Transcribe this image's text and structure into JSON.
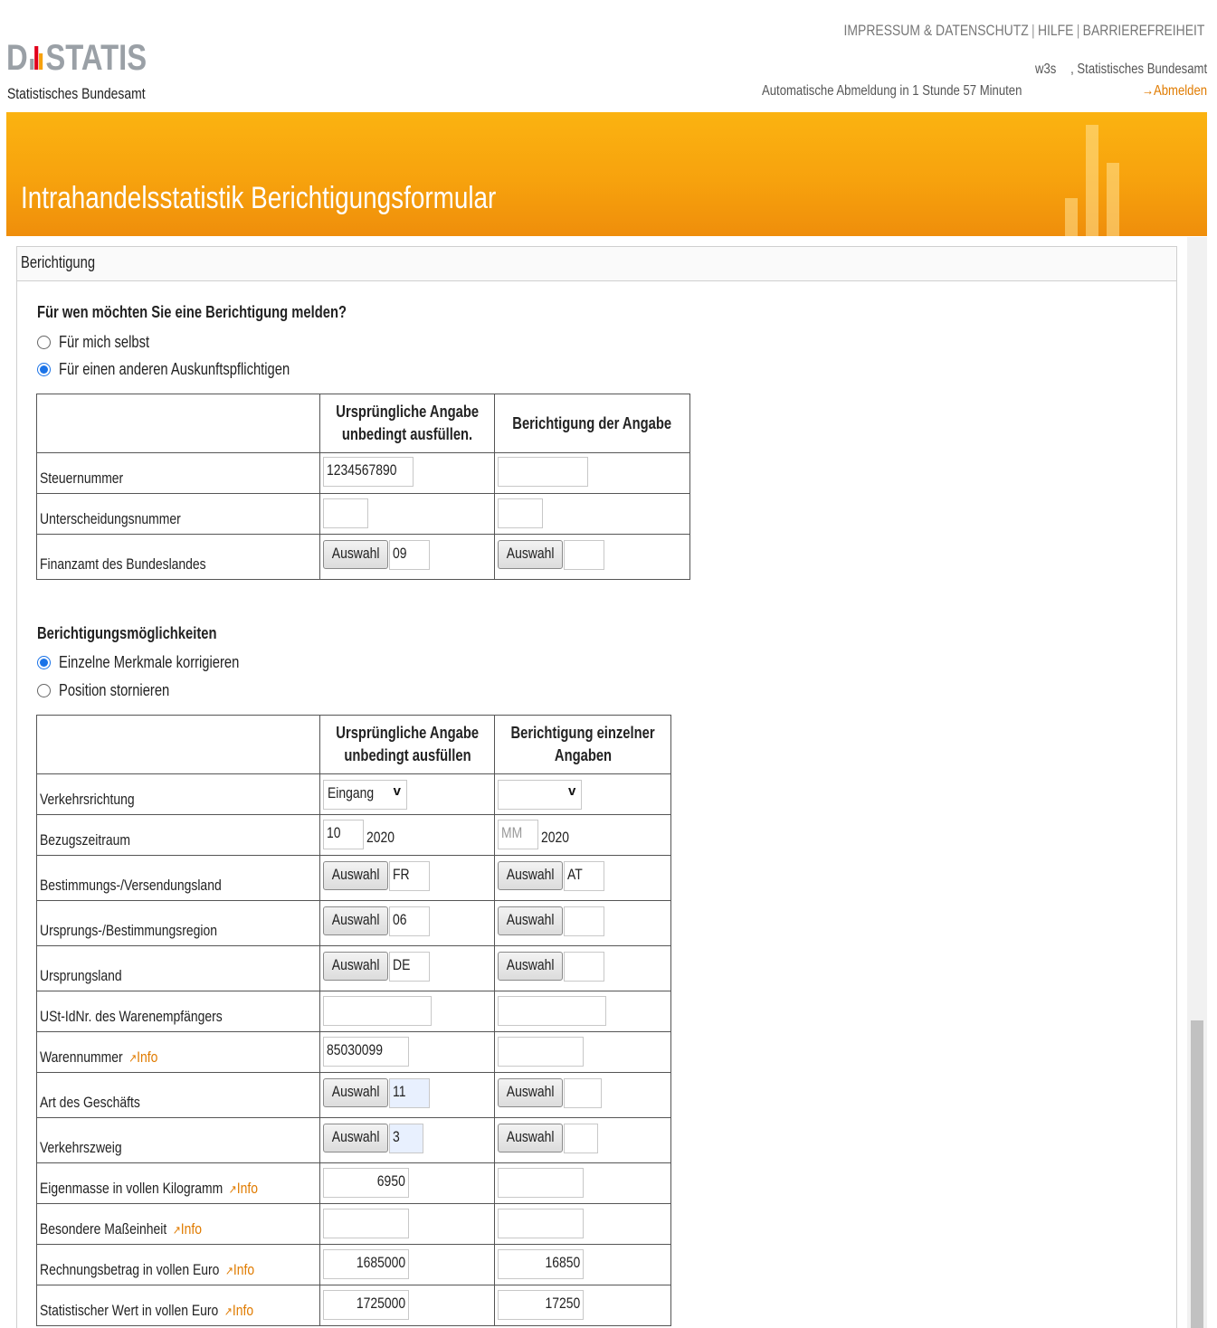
{
  "header": {
    "logo_text_d": "D",
    "logo_text_statis": "STATIS",
    "logo_sub": "Statistisches Bundesamt",
    "top_links": [
      "IMPRESSUM & DATENSCHUTZ",
      "HILFE",
      "BARRIEREFREIHEIT"
    ],
    "user": "w3s",
    "organisation": ", Statistisches Bundesamt",
    "autologout": "Automatische Abmeldung in 1 Stunde 57 Minuten",
    "logout": "Abmelden",
    "logout_arrow": "→"
  },
  "banner": {
    "title": "Intrahandelsstatistik Berichtigungsformular"
  },
  "panel": {
    "title": "Berichtigung"
  },
  "section1": {
    "question": "Für wen möchten Sie eine Berichtigung melden?",
    "options": [
      "Für mich selbst",
      "Für einen anderen Auskunftspflichtigen"
    ],
    "selected_index": 1,
    "table": {
      "col_original": [
        "Ursprüngliche Angabe",
        "unbedingt ausfüllen."
      ],
      "col_correction": "Berichtigung der Angabe",
      "rows": {
        "steuernummer": {
          "label": "Steuernummer",
          "original": "1234567890",
          "correction": ""
        },
        "unterscheidungsnummer": {
          "label": "Unterscheidungsnummer",
          "original": "",
          "correction": ""
        },
        "finanzamt": {
          "label": "Finanzamt des Bundeslandes",
          "original": "09",
          "correction": ""
        }
      }
    }
  },
  "section2": {
    "question": "Berichtigungsmöglichkeiten",
    "options": [
      "Einzelne Merkmale korrigieren",
      "Position stornieren"
    ],
    "selected_index": 0,
    "table": {
      "col_original": [
        "Ursprüngliche Angabe",
        "unbedingt ausfüllen"
      ],
      "col_correction": [
        "Berichtigung einzelner",
        "Angaben"
      ],
      "rows": {
        "verkehrsrichtung": {
          "label": "Verkehrsrichtung",
          "original": "Eingang",
          "correction": ""
        },
        "bezugszeitraum": {
          "label": "Bezugszeitraum",
          "original_month": "10",
          "original_year": "2020",
          "correction_month_placeholder": "MM",
          "correction_year": "2020"
        },
        "bestimmungsland": {
          "label": "Bestimmungs-/Versendungsland",
          "original": "FR",
          "correction": "AT"
        },
        "region": {
          "label": "Ursprungs-/Bestimmungsregion",
          "original": "06",
          "correction": ""
        },
        "ursprungsland": {
          "label": "Ursprungsland",
          "original": "DE",
          "correction": ""
        },
        "ustid": {
          "label": "USt-IdNr. des Warenempfängers",
          "original": "",
          "correction": ""
        },
        "warennummer": {
          "label": "Warennummer",
          "original": "85030099",
          "correction": ""
        },
        "art_geschaeft": {
          "label": "Art des Geschäfts",
          "original": "11",
          "correction": ""
        },
        "verkehrszweig": {
          "label": "Verkehrszweig",
          "original": "3",
          "correction": ""
        },
        "eigenmasse": {
          "label": "Eigenmasse in vollen Kilogramm",
          "original": "6950",
          "correction": ""
        },
        "masseinheit": {
          "label": "Besondere Maßeinheit",
          "original": "",
          "correction": ""
        },
        "rechnungsbetrag": {
          "label": "Rechnungsbetrag in vollen Euro",
          "original": "1685000",
          "correction": "16850"
        },
        "stat_wert": {
          "label": "Statistischer Wert in vollen Euro",
          "original": "1725000",
          "correction": "17250"
        }
      }
    }
  },
  "labels": {
    "auswahl": "Auswahl",
    "info": "Info",
    "chevron": "v",
    "info_icon": "↗"
  },
  "colors": {
    "accent": "#e07b00",
    "banner": "#f7a20d",
    "radio": "#1a73e8"
  }
}
